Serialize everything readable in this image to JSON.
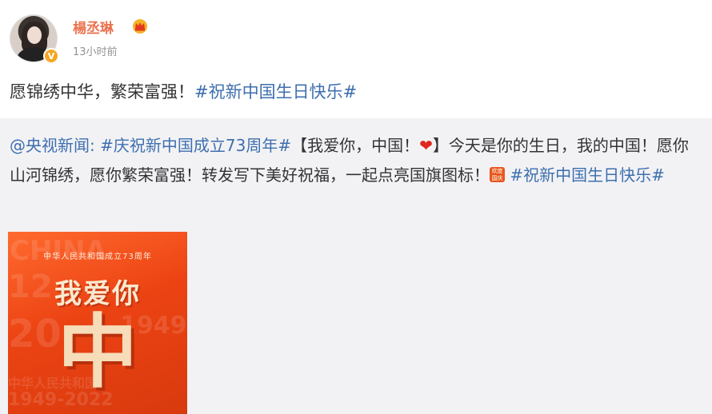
{
  "post": {
    "username": "楊丞琳",
    "timestamp": "13小时前",
    "text_main": "愿锦绣中华，繁荣富强！",
    "text_topic": "#祝新中国生日快乐#"
  },
  "repost": {
    "mention": "@央视新闻:",
    "topic1": "#庆祝新中国成立73周年#",
    "text1": "【我爱你，中国！",
    "text2": "】今天是你的生日，我的中国！愿你山河锦绣，愿你繁荣富强！转发写下美好祝福，一起点亮国旗图标！",
    "topic2": "#祝新中国生日快乐#",
    "badge_text": "欢度国庆"
  },
  "poster": {
    "subtitle": "中华人民共和国成立73周年",
    "title": "我爱你",
    "big": "中",
    "bg_words": [
      "CHINA",
      "12",
      "20",
      "1949",
      "中华人民共和国",
      "1949-2022"
    ]
  },
  "icons": {
    "crown": "crown-icon",
    "verified": "verified-icon",
    "heart": "heart-icon"
  },
  "colors": {
    "username": "#eb7350",
    "link": "#3e6fae",
    "repost_bg": "#f2f2f5",
    "poster_red": "#ec4313"
  }
}
